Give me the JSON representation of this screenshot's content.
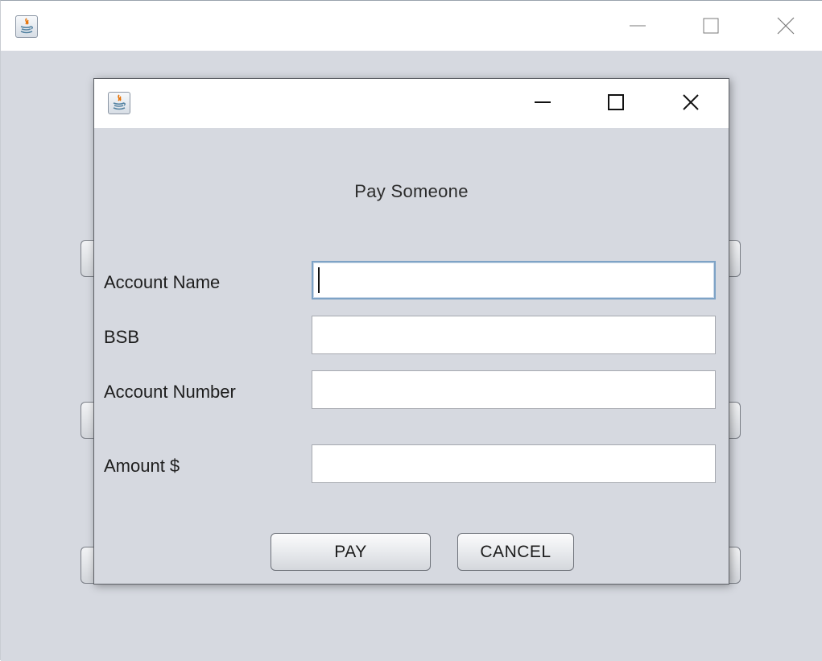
{
  "dialog": {
    "heading": "Pay Someone",
    "fields": [
      {
        "label": "Account Name",
        "value": "",
        "focused": true
      },
      {
        "label": "BSB",
        "value": ""
      },
      {
        "label": "Account Number",
        "value": ""
      },
      {
        "label": "Amount $",
        "value": ""
      }
    ],
    "buttons": {
      "pay": "PAY",
      "cancel": "CANCEL"
    }
  },
  "icons": {
    "app": "java-coffee-cup-icon",
    "minimize": "minimize-icon",
    "maximize": "maximize-icon",
    "close": "close-icon"
  },
  "colors": {
    "client_background": "#d6d9e0",
    "focus_border": "#7ea3c6",
    "java_orange": "#e76f00",
    "java_blue": "#5382a1"
  }
}
